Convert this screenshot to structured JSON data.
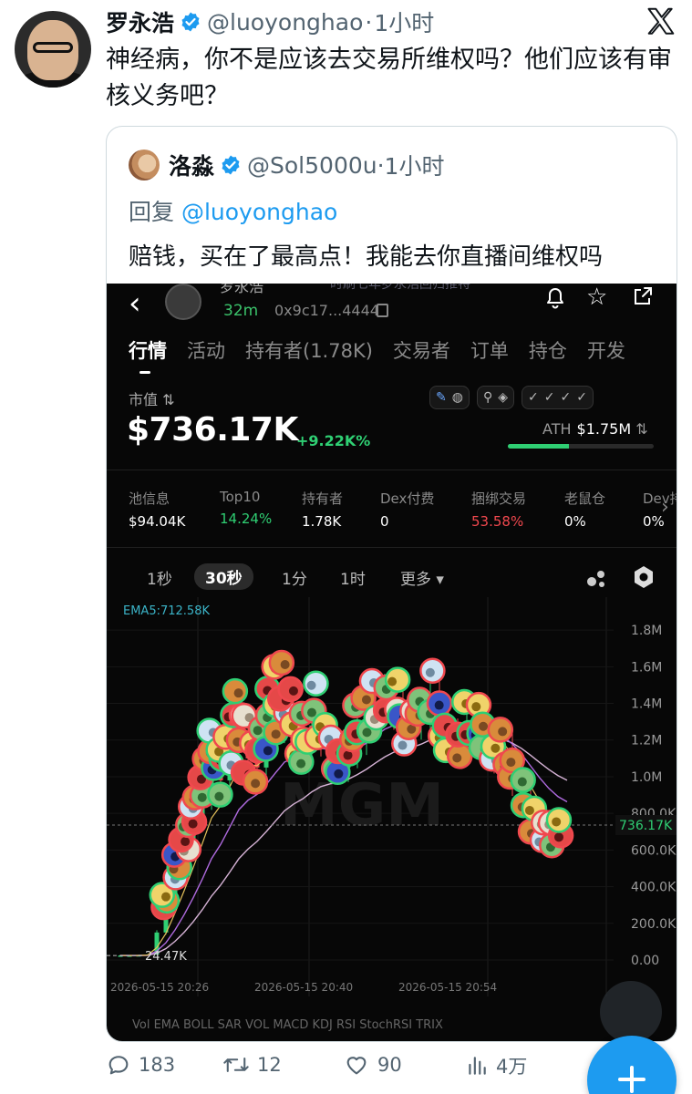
{
  "tweet": {
    "author_name": "罗永浩",
    "author_handle": "@luoyonghao",
    "separator": "·",
    "time": "1小时",
    "text": "神经病，你不是应该去交易所维权吗？他们应该有审核义务吧？"
  },
  "quoted": {
    "author_name": "洛淼",
    "author_handle": "@Sol5000u",
    "separator": "·",
    "time": "1小时",
    "reply_prefix": "回复",
    "reply_mention": "@luoyonghao",
    "text": "赔钱，买在了最高点！我能去你直播间维权吗"
  },
  "app": {
    "title": "罗永浩",
    "subtitle": "时刷七年罗永浩回归推特",
    "token_age": "32m",
    "token_address": "0x9c17...4444",
    "tabs": [
      "行情",
      "活动",
      "持有者(1.78K)",
      "交易者",
      "订单",
      "持仓",
      "开发"
    ],
    "active_tab": 0,
    "market_cap_label": "市值",
    "market_cap_value": "$736.17K",
    "market_cap_change": "+9.22K%",
    "ath_label": "ATH",
    "ath_value": "$1.75M",
    "ath_progress": 0.42,
    "stats": [
      {
        "label": "池信息",
        "value": "$94.04K",
        "color": "#ffffff"
      },
      {
        "label": "Top10",
        "value": "14.24%",
        "color": "#2fcf73"
      },
      {
        "label": "持有者",
        "value": "1.78K",
        "color": "#ffffff"
      },
      {
        "label": "Dex付费",
        "value": "0",
        "color": "#ffffff"
      },
      {
        "label": "捆绑交易",
        "value": "53.58%",
        "color": "#f0484e"
      },
      {
        "label": "老鼠仓",
        "value": "0%",
        "color": "#ffffff"
      },
      {
        "label": "Dev持",
        "value": "0%",
        "color": "#ffffff"
      }
    ],
    "intervals": [
      "1秒",
      "30秒",
      "1分",
      "1时",
      "更多"
    ],
    "active_interval": 1,
    "ema_legend": "EMA5:712.58K",
    "bottom_indicators": "Vol  EMA  BOLL  SAR  VOL  MACD  KDJ  RSI  StochRSI  TRIX",
    "colors": {
      "up": "#2fcf73",
      "down": "#f0484e",
      "ema5": "#e6c35c",
      "ema10": "#b06be0",
      "ema20": "#d6b3d6"
    }
  },
  "chart_data": {
    "type": "candlestick",
    "y_ticks": [
      "1.8M",
      "1.6M",
      "1.4M",
      "1.2M",
      "1.0M",
      "800.0K",
      "600.0K",
      "400.0K",
      "200.0K",
      "0.00"
    ],
    "y_range": [
      0,
      1900000
    ],
    "x_ticks": [
      "2026-05-15 20:26",
      "2026-05-15 20:40",
      "2026-05-15 20:54"
    ],
    "current_price_label": "736.17K",
    "current_price": 736170,
    "low_label": "24.47K",
    "low_value": 24470,
    "close_series": [
      24470,
      24470,
      26000,
      30000,
      150000,
      300000,
      480000,
      620000,
      760000,
      900000,
      1050000,
      980000,
      1150000,
      1250000,
      1100000,
      1050000,
      1200000,
      1300000,
      1350000,
      1200000,
      1150000,
      1280000,
      1220000,
      1100000,
      1050000,
      1150000,
      1250000,
      1320000,
      1400000,
      1420000,
      1380000,
      1250000,
      1300000,
      1350000,
      1420000,
      1300000,
      1220000,
      1180000,
      1260000,
      1300000,
      1200000,
      1100000,
      1150000,
      1000000,
      880000,
      760000,
      700000,
      680000,
      690000,
      736170
    ]
  },
  "actions": {
    "replies": "183",
    "retweets": "12",
    "likes": "90",
    "views": "4万"
  }
}
